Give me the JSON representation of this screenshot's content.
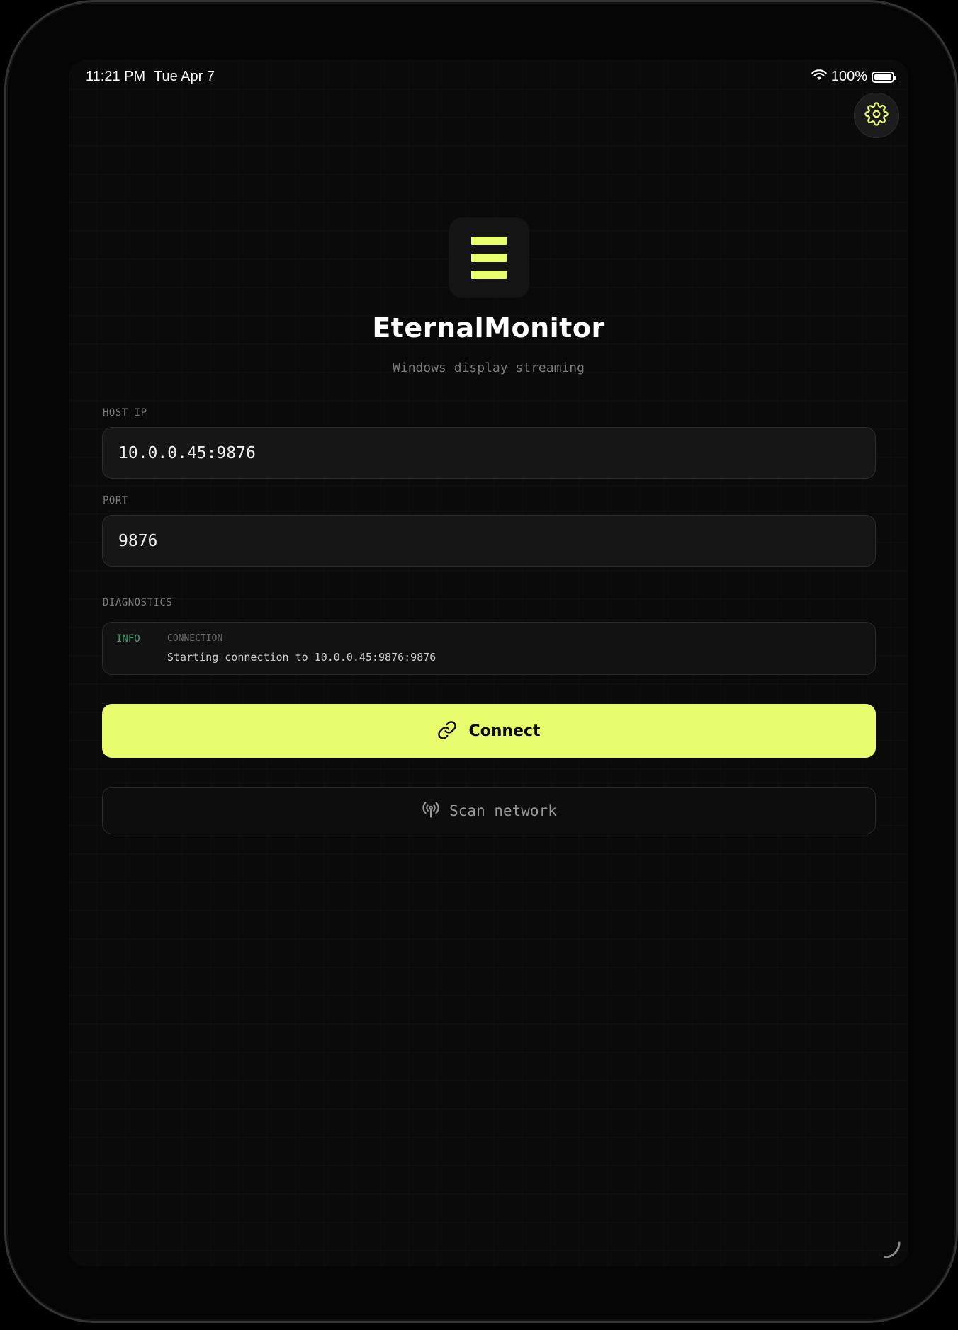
{
  "status_bar": {
    "time": "11:21 PM",
    "date": "Tue Apr 7",
    "battery": "100%",
    "wifi_icon": "wifi-icon",
    "battery_icon": "battery-icon"
  },
  "header": {
    "settings_icon": "gear-icon",
    "accent_color": "#e9fc6d"
  },
  "app": {
    "logo_icon": "three-bars-logo-icon",
    "title": "EternalMonitor",
    "subtitle": "Windows display streaming"
  },
  "form": {
    "host_ip": {
      "label": "HOST IP",
      "value": "10.0.0.45:9876"
    },
    "port": {
      "label": "PORT",
      "value": "9876"
    }
  },
  "diagnostics": {
    "label": "DIAGNOSTICS",
    "entries": [
      {
        "level": "INFO",
        "category": "CONNECTION",
        "message": "Starting connection to 10.0.0.45:9876:9876",
        "level_color": "#3f9f74"
      }
    ]
  },
  "actions": {
    "connect_label": "Connect",
    "connect_icon": "link-icon",
    "scan_label": "Scan network",
    "scan_icon": "antenna-icon"
  }
}
